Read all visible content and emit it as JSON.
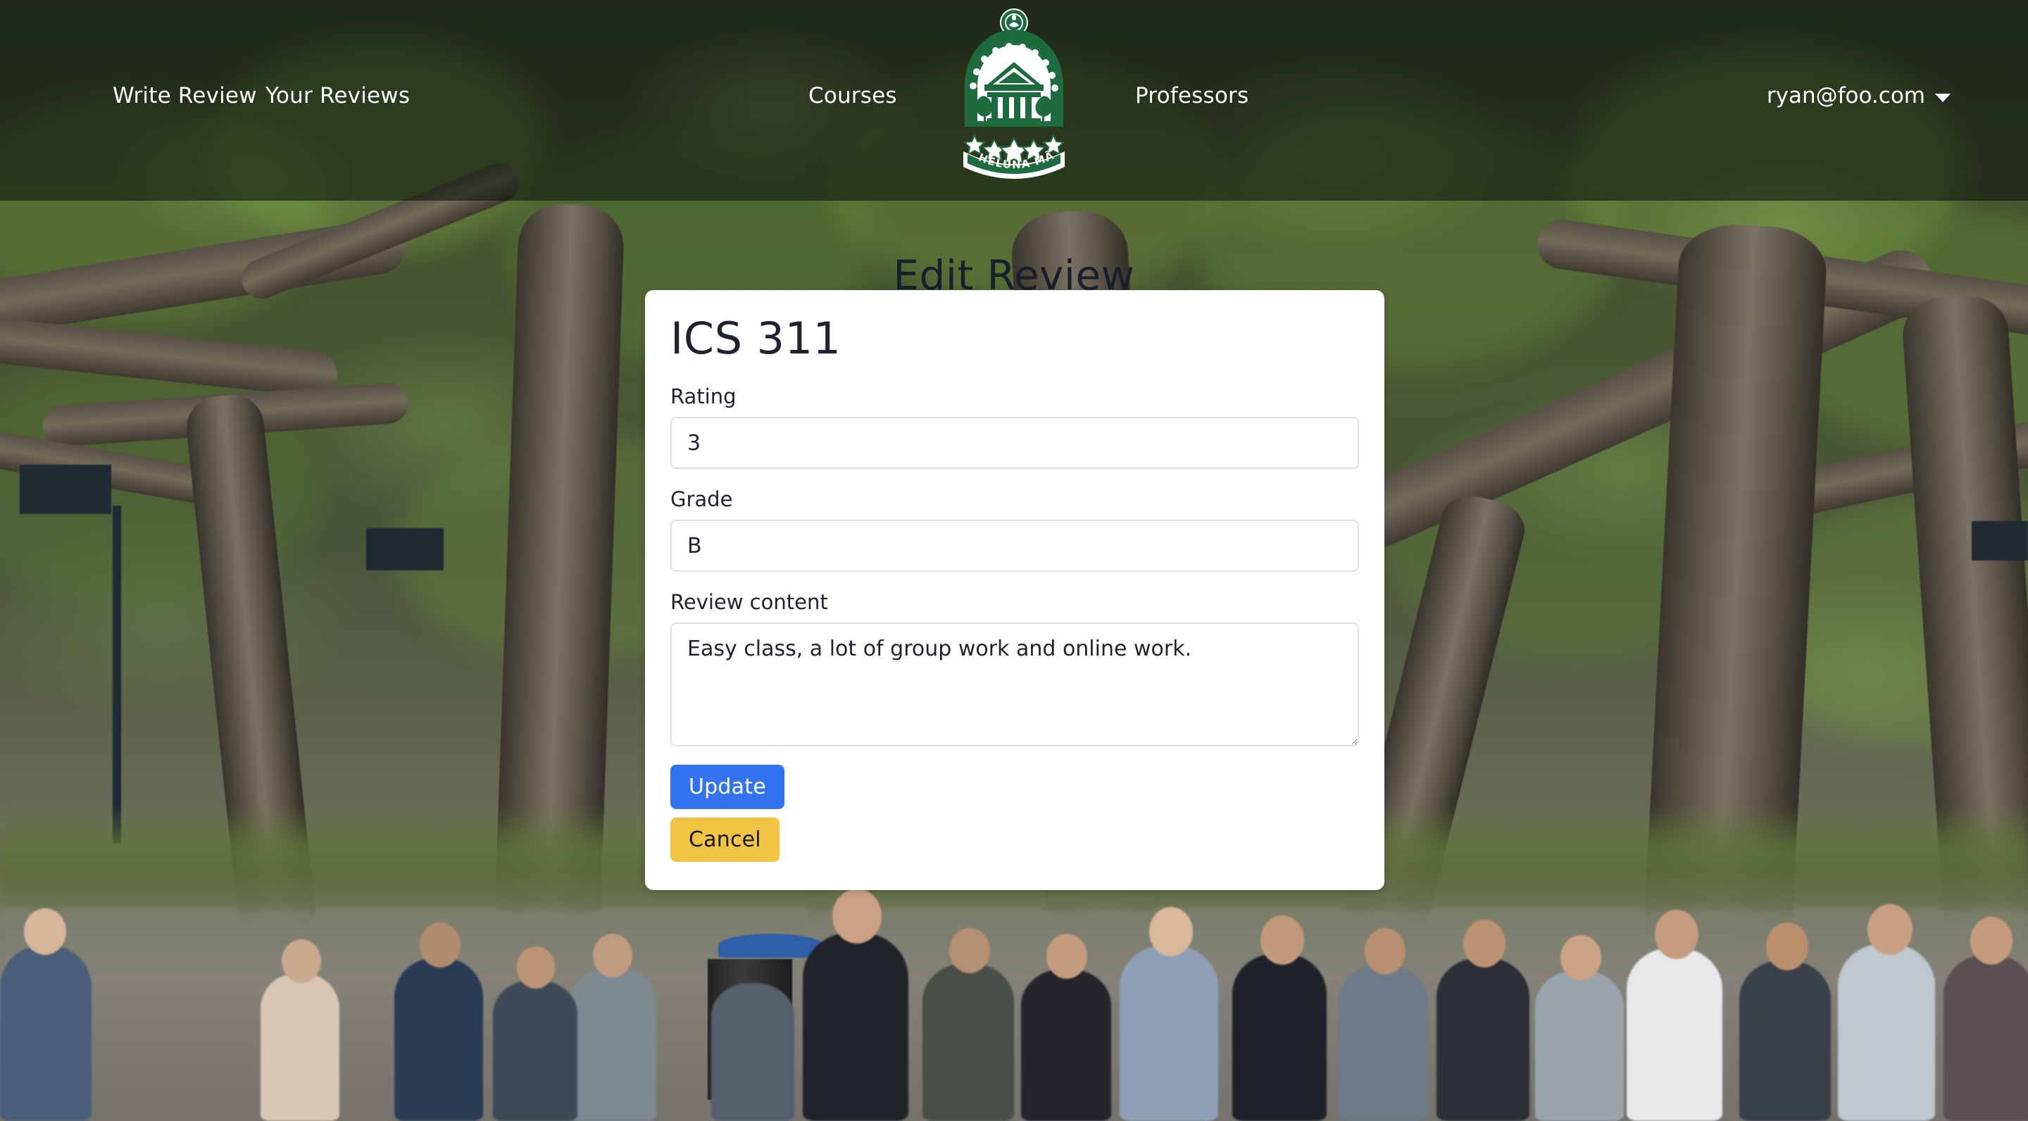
{
  "navbar": {
    "links": [
      {
        "id": "write-review",
        "label": "Write Review"
      },
      {
        "id": "your-reviews",
        "label": "Your Reviews"
      },
      {
        "id": "courses",
        "label": "Courses"
      },
      {
        "id": "professors",
        "label": "Professors"
      }
    ],
    "user": {
      "email": "ryan@foo.com",
      "caret_icon": "chevron-down-icon"
    },
    "logo": {
      "icon": "university-crest-icon",
      "banner_text": "HELUNA MĀNOA",
      "color": "#1d6b3f",
      "star_count": 5
    },
    "overlay_color": "#12180e"
  },
  "page": {
    "title": "Edit Review",
    "title_color": "#1a1f2b"
  },
  "card": {
    "course_title": "ICS 311",
    "fields": [
      {
        "id": "rating",
        "label": "Rating",
        "value": "3",
        "type": "input"
      },
      {
        "id": "grade",
        "label": "Grade",
        "value": "B",
        "type": "input"
      },
      {
        "id": "content",
        "label": "Review content",
        "value": "Easy class, a lot of group work and online work.",
        "type": "textarea"
      }
    ],
    "buttons": [
      {
        "id": "update",
        "label": "Update",
        "color": "#3273f0",
        "text_color": "#ffffff"
      },
      {
        "id": "cancel",
        "label": "Cancel",
        "color": "#f2c444",
        "text_color": "#151515"
      }
    ],
    "background": "#ffffff"
  }
}
